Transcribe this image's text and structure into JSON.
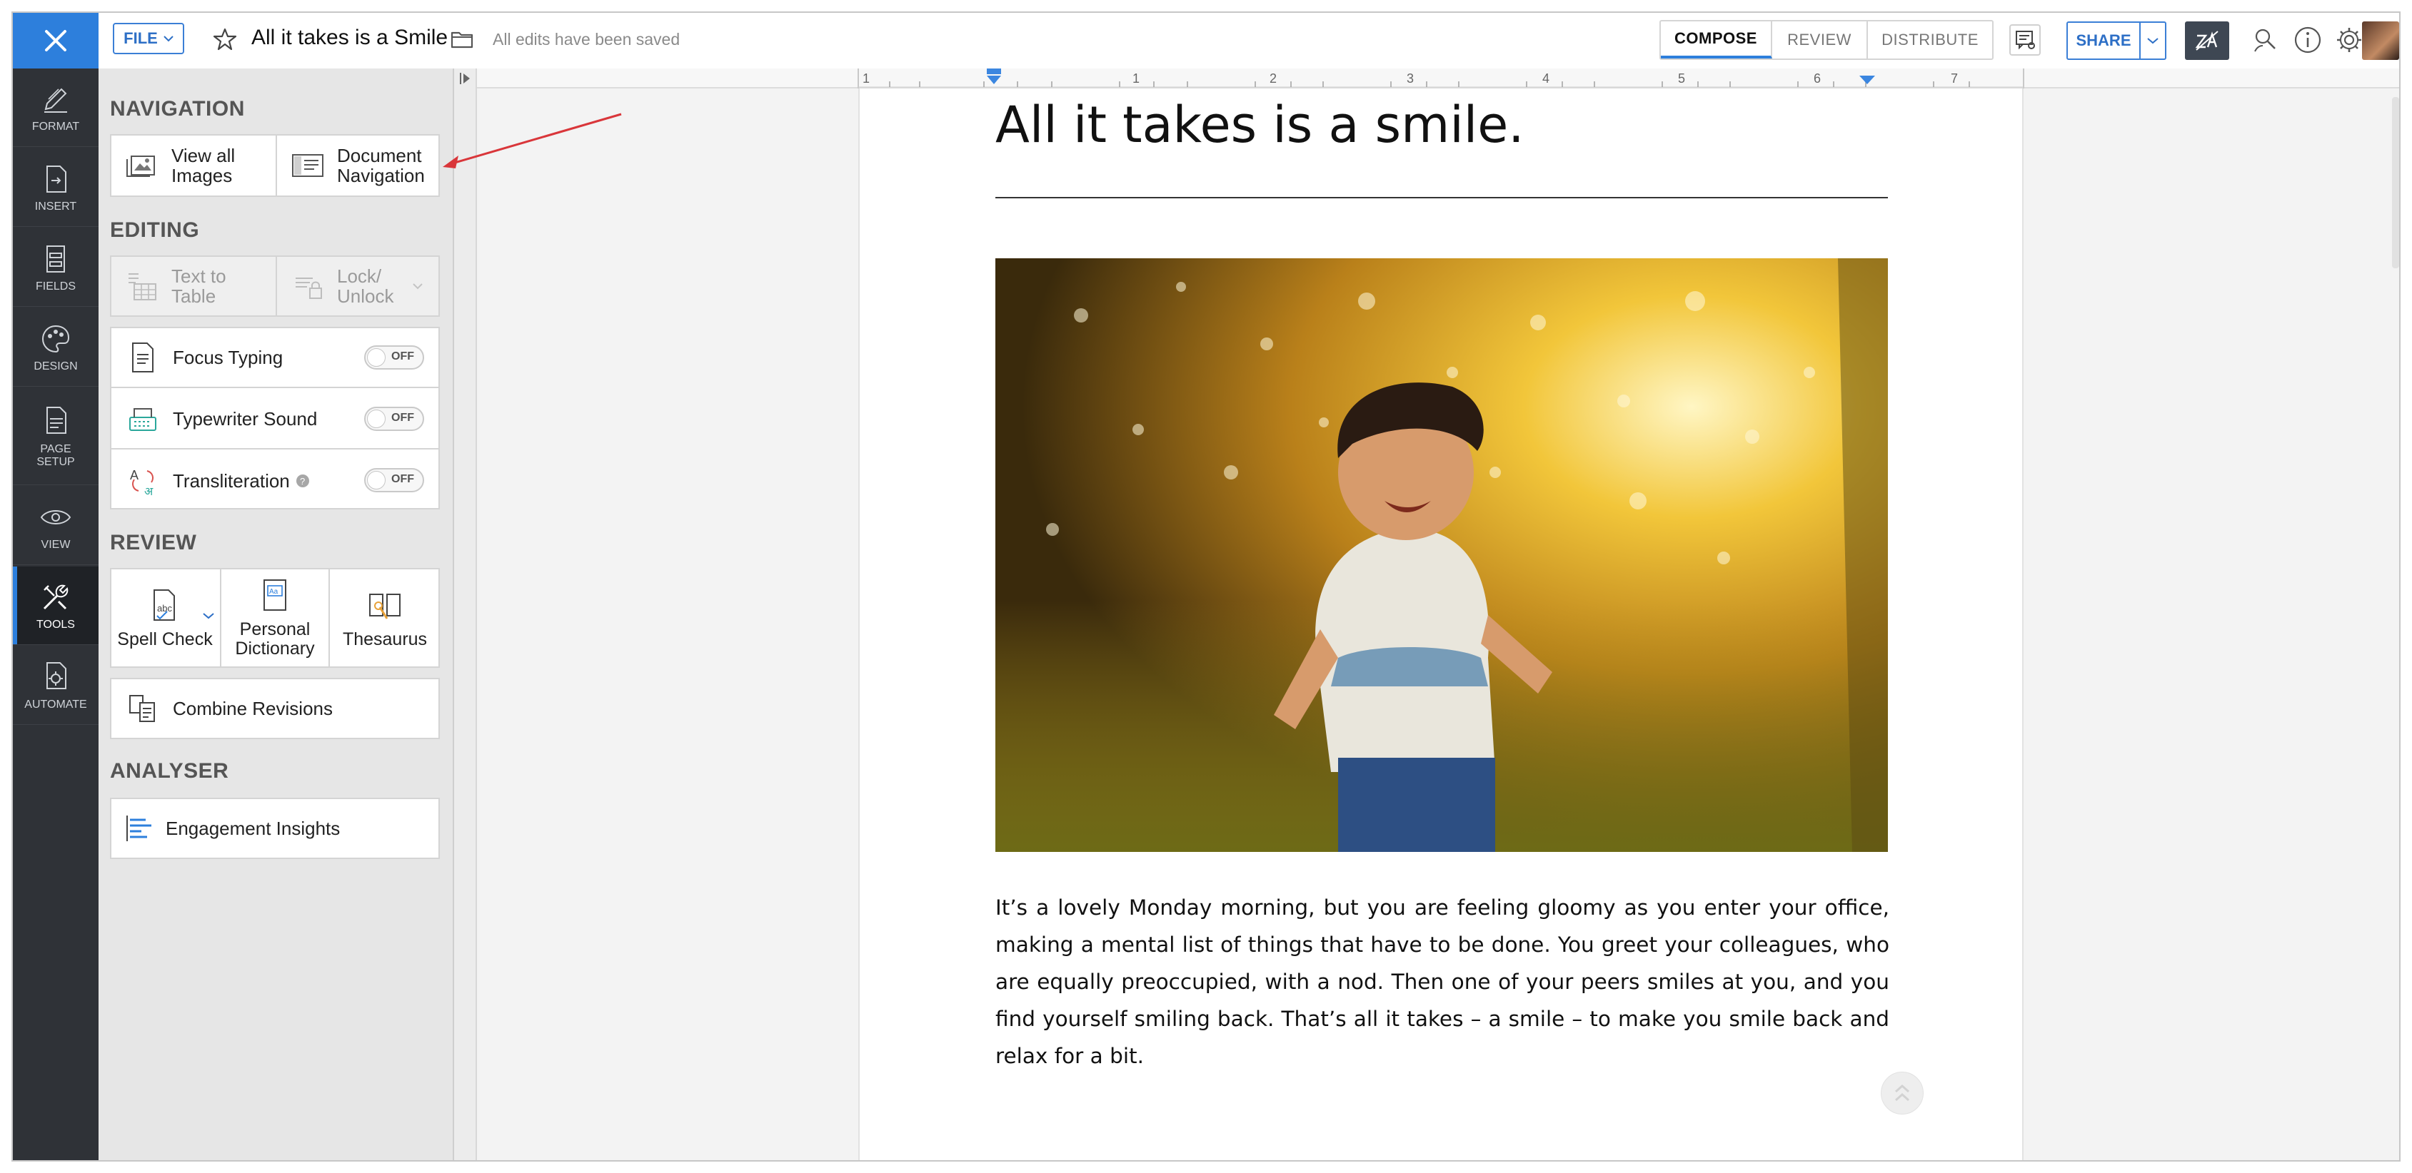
{
  "topbar": {
    "file_label": "FILE",
    "doc_title": "All it takes is a Smile",
    "save_status": "All edits have been saved",
    "modes": [
      {
        "label": "COMPOSE",
        "active": true
      },
      {
        "label": "REVIEW",
        "active": false
      },
      {
        "label": "DISTRIBUTE",
        "active": false
      }
    ],
    "share_label": "SHARE",
    "accent_color": "#2d7fdc"
  },
  "rail": {
    "items": [
      {
        "label": "FORMAT",
        "icon": "pen-icon"
      },
      {
        "label": "INSERT",
        "icon": "insert-icon"
      },
      {
        "label": "FIELDS",
        "icon": "fields-icon"
      },
      {
        "label": "DESIGN",
        "icon": "palette-icon"
      },
      {
        "label": "PAGE SETUP",
        "icon": "page-setup-icon"
      },
      {
        "label": "VIEW",
        "icon": "eye-icon"
      },
      {
        "label": "TOOLS",
        "icon": "tools-icon",
        "active": true
      },
      {
        "label": "AUTOMATE",
        "icon": "automate-icon"
      }
    ]
  },
  "panel": {
    "navigation": {
      "title": "NAVIGATION",
      "view_images_label": "View all Images",
      "doc_nav_label": "Document Navigation"
    },
    "editing": {
      "title": "EDITING",
      "text_to_table_label": "Text to Table",
      "lock_unlock_label": "Lock/ Unlock",
      "focus_typing_label": "Focus Typing",
      "typewriter_label": "Typewriter Sound",
      "transliteration_label": "Transliteration",
      "toggle_off_label": "OFF"
    },
    "review": {
      "title": "REVIEW",
      "spell_check_label": "Spell Check",
      "personal_dictionary_label": "Personal Dictionary",
      "thesaurus_label": "Thesaurus",
      "combine_revisions_label": "Combine Revisions"
    },
    "analyser": {
      "title": "ANALYSER",
      "engagement_label": "Engagement Insights"
    }
  },
  "ruler": {
    "marks": [
      "1",
      "1",
      "2",
      "3",
      "4",
      "5",
      "6",
      "7"
    ]
  },
  "document": {
    "heading": "All it takes is a smile.",
    "body": "It’s a lovely Monday morning, but you are feeling gloomy as you enter your office, making a mental list of things that have to be done. You greet your colleagues, who are equally preoccupied, with a nod. Then one of your peers smiles at you, and you find yourself smiling back. That’s all it takes – a smile – to make you smile back and relax for a bit."
  }
}
